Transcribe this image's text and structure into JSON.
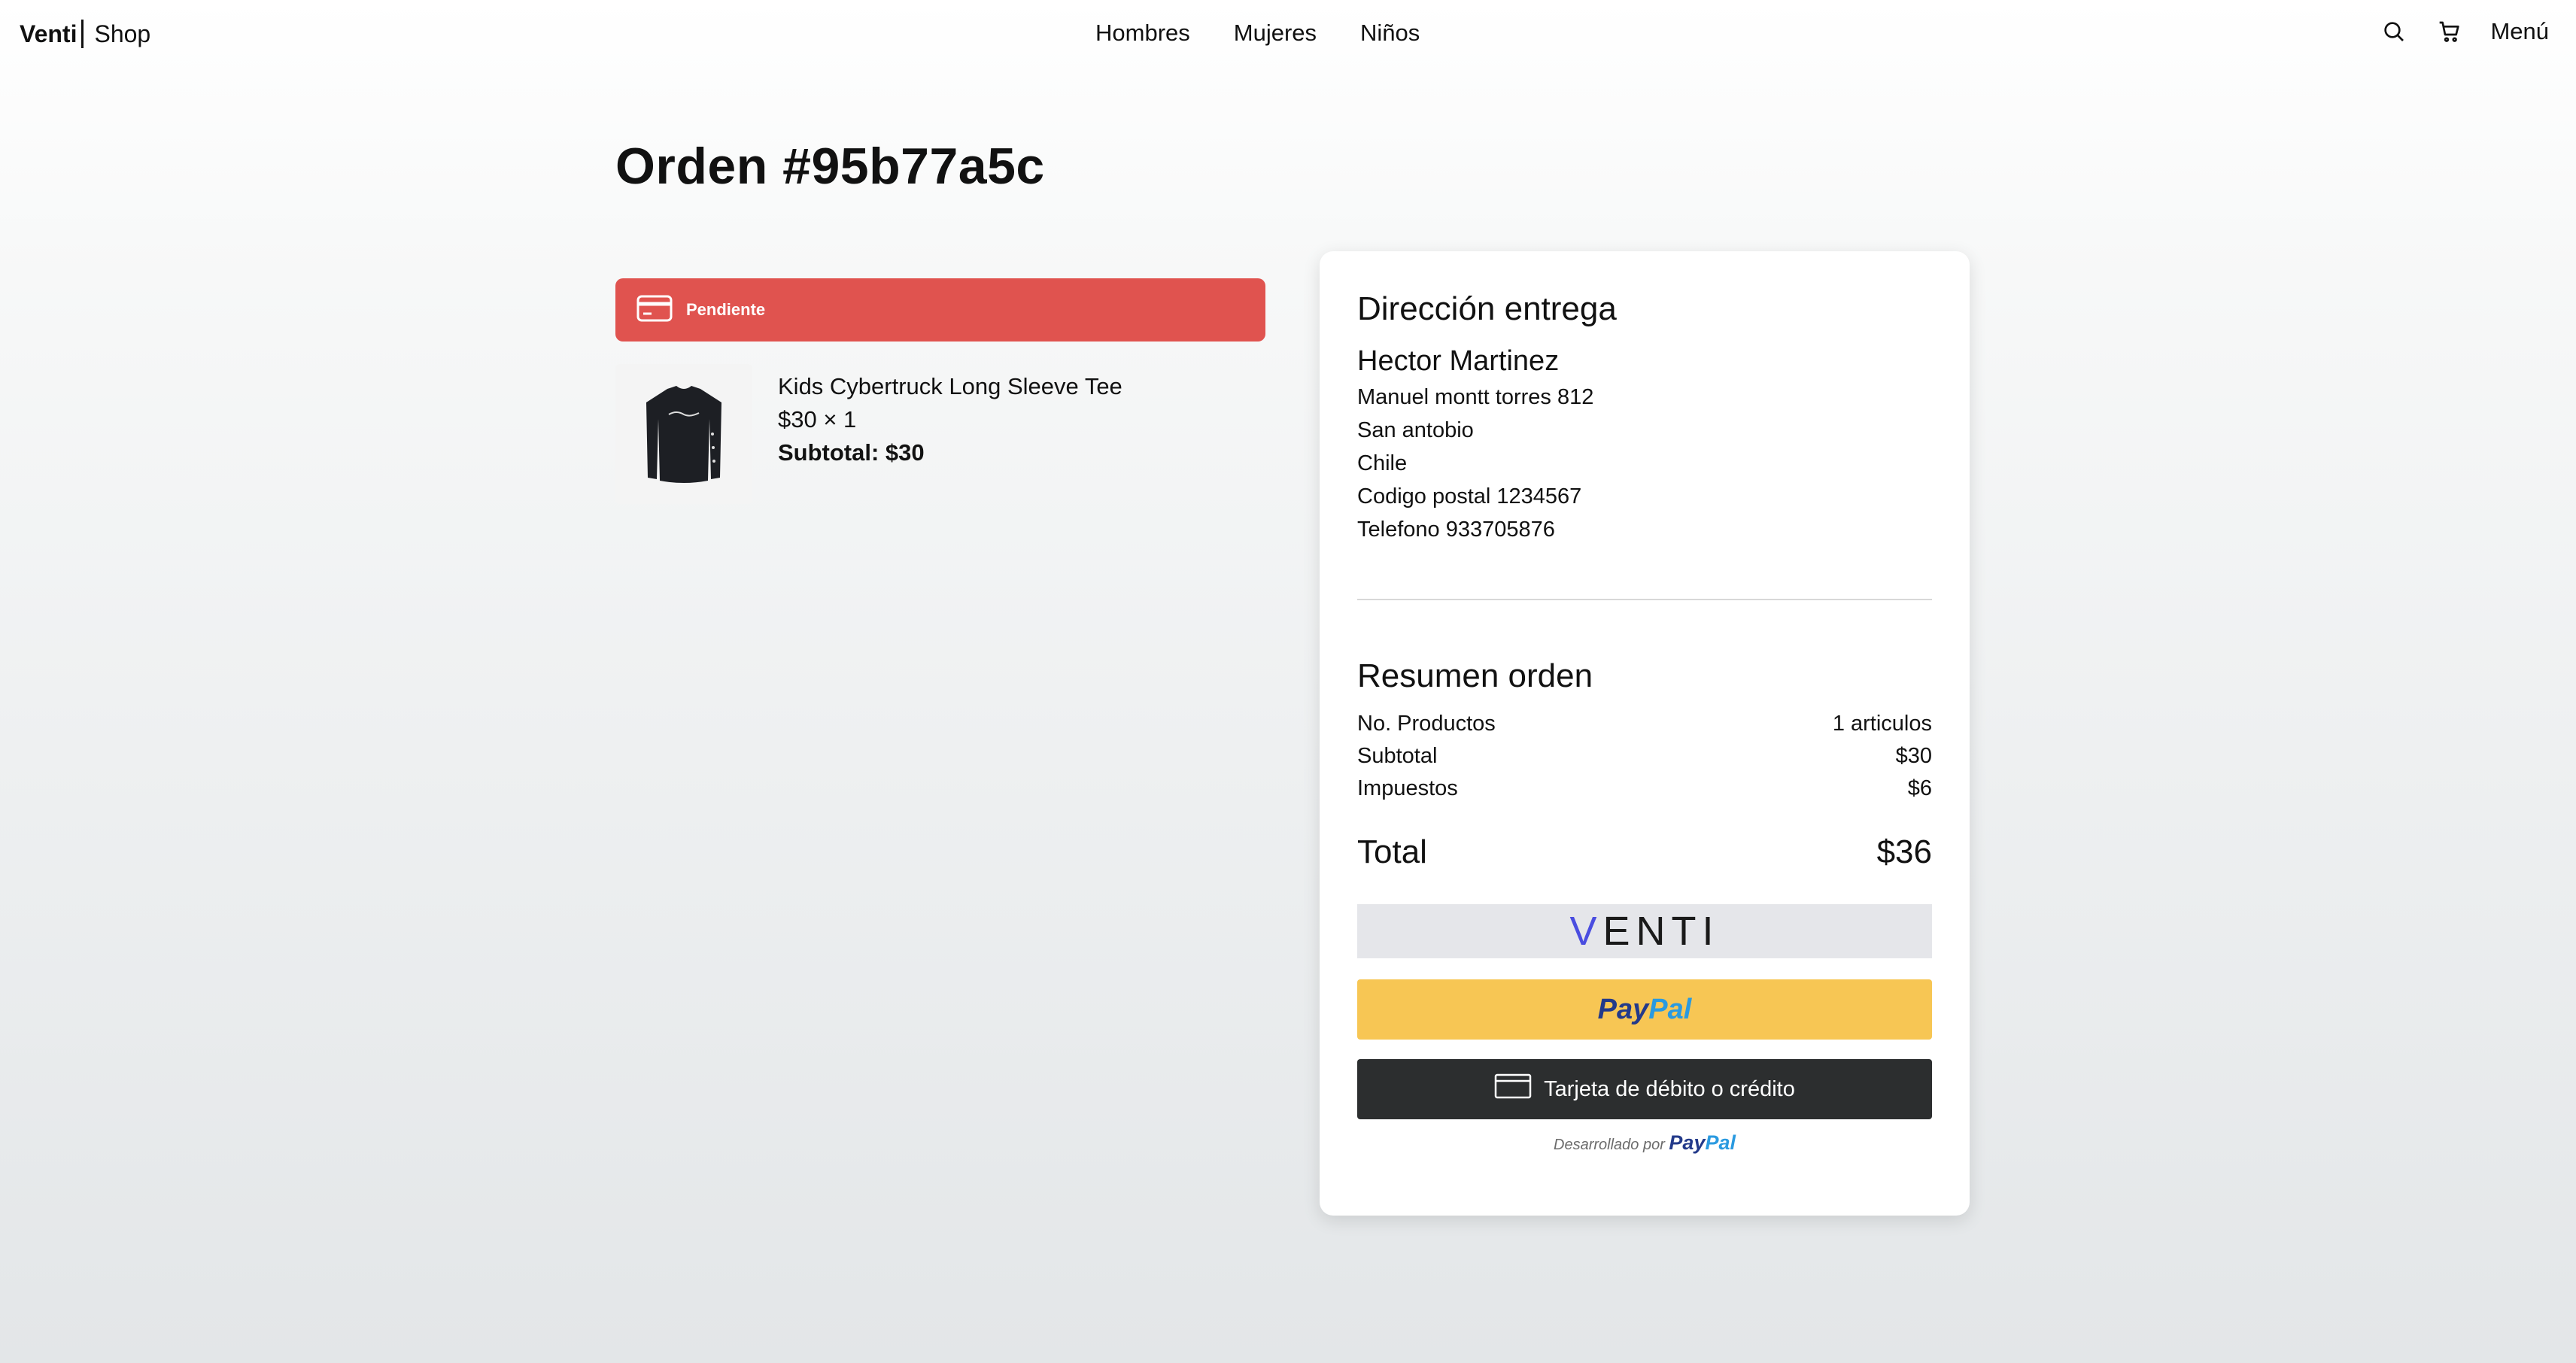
{
  "nav": {
    "brand_bold": "Venti",
    "brand_light": "Shop",
    "links": [
      "Hombres",
      "Mujeres",
      "Niños"
    ],
    "search_icon": "search-icon",
    "cart_icon": "cart-icon",
    "menu_label": "Menú"
  },
  "order": {
    "title": "Orden #95b77a5c",
    "status": "Pendiente",
    "status_color": "#e0534f",
    "item": {
      "name": "Kids Cybertruck Long Sleeve Tee",
      "price_qty": "$30 × 1",
      "subtotal": "Subtotal: $30"
    }
  },
  "delivery": {
    "heading": "Dirección entrega",
    "name": "Hector Martinez",
    "street": "Manuel montt torres 812",
    "city": "San antobio",
    "country": "Chile",
    "postal": "Codigo postal 1234567",
    "phone": "Telefono 933705876"
  },
  "summary": {
    "heading": "Resumen orden",
    "rows": [
      {
        "label": "No. Productos",
        "value": "1 articulos"
      },
      {
        "label": "Subtotal",
        "value": "$30"
      },
      {
        "label": "Impuestos",
        "value": "$6"
      }
    ],
    "total_label": "Total",
    "total_value": "$36"
  },
  "payment": {
    "venti_logo": "VENTI",
    "paypal_pay": "Pay",
    "paypal_pal": "Pal",
    "card_label": "Tarjeta de débito o crédito",
    "powered_prefix": "Desarrollado por",
    "paypal_yellow": "#f7c654",
    "card_dark": "#2c2e2f"
  }
}
